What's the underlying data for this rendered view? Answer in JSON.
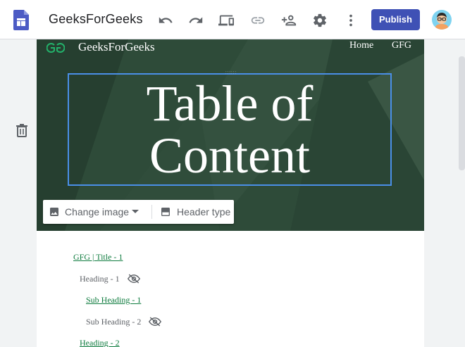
{
  "app": {
    "site_name": "GeeksForGeeks",
    "publish_label": "Publish",
    "accent_color": "#3f51b5",
    "icons": [
      "google-sites-logo",
      "undo-icon",
      "redo-icon",
      "preview-devices-icon",
      "link-icon",
      "share-add-person-icon",
      "settings-gear-icon",
      "more-vert-icon",
      "avatar"
    ]
  },
  "header": {
    "logo_text": "GG",
    "site_title": "GeeksForGeeks",
    "nav": [
      "Home",
      "GFG"
    ],
    "title": "Table of Content",
    "background_color": "#2d4a38",
    "change_image_label": "Change image",
    "header_type_label": "Header type"
  },
  "toc": {
    "link_color": "#0f7c3f",
    "items": [
      {
        "text": "GFG | Title - 1",
        "style": "link",
        "hidden_toggle": false
      },
      {
        "text": "Heading - 1",
        "style": "plain",
        "hidden_toggle": true
      },
      {
        "text": "Sub Heading - 1",
        "style": "link",
        "hidden_toggle": false
      },
      {
        "text": "Sub Heading - 2",
        "style": "plain",
        "hidden_toggle": true
      },
      {
        "text": "Heading - 2",
        "style": "link",
        "hidden_toggle": false
      }
    ]
  }
}
